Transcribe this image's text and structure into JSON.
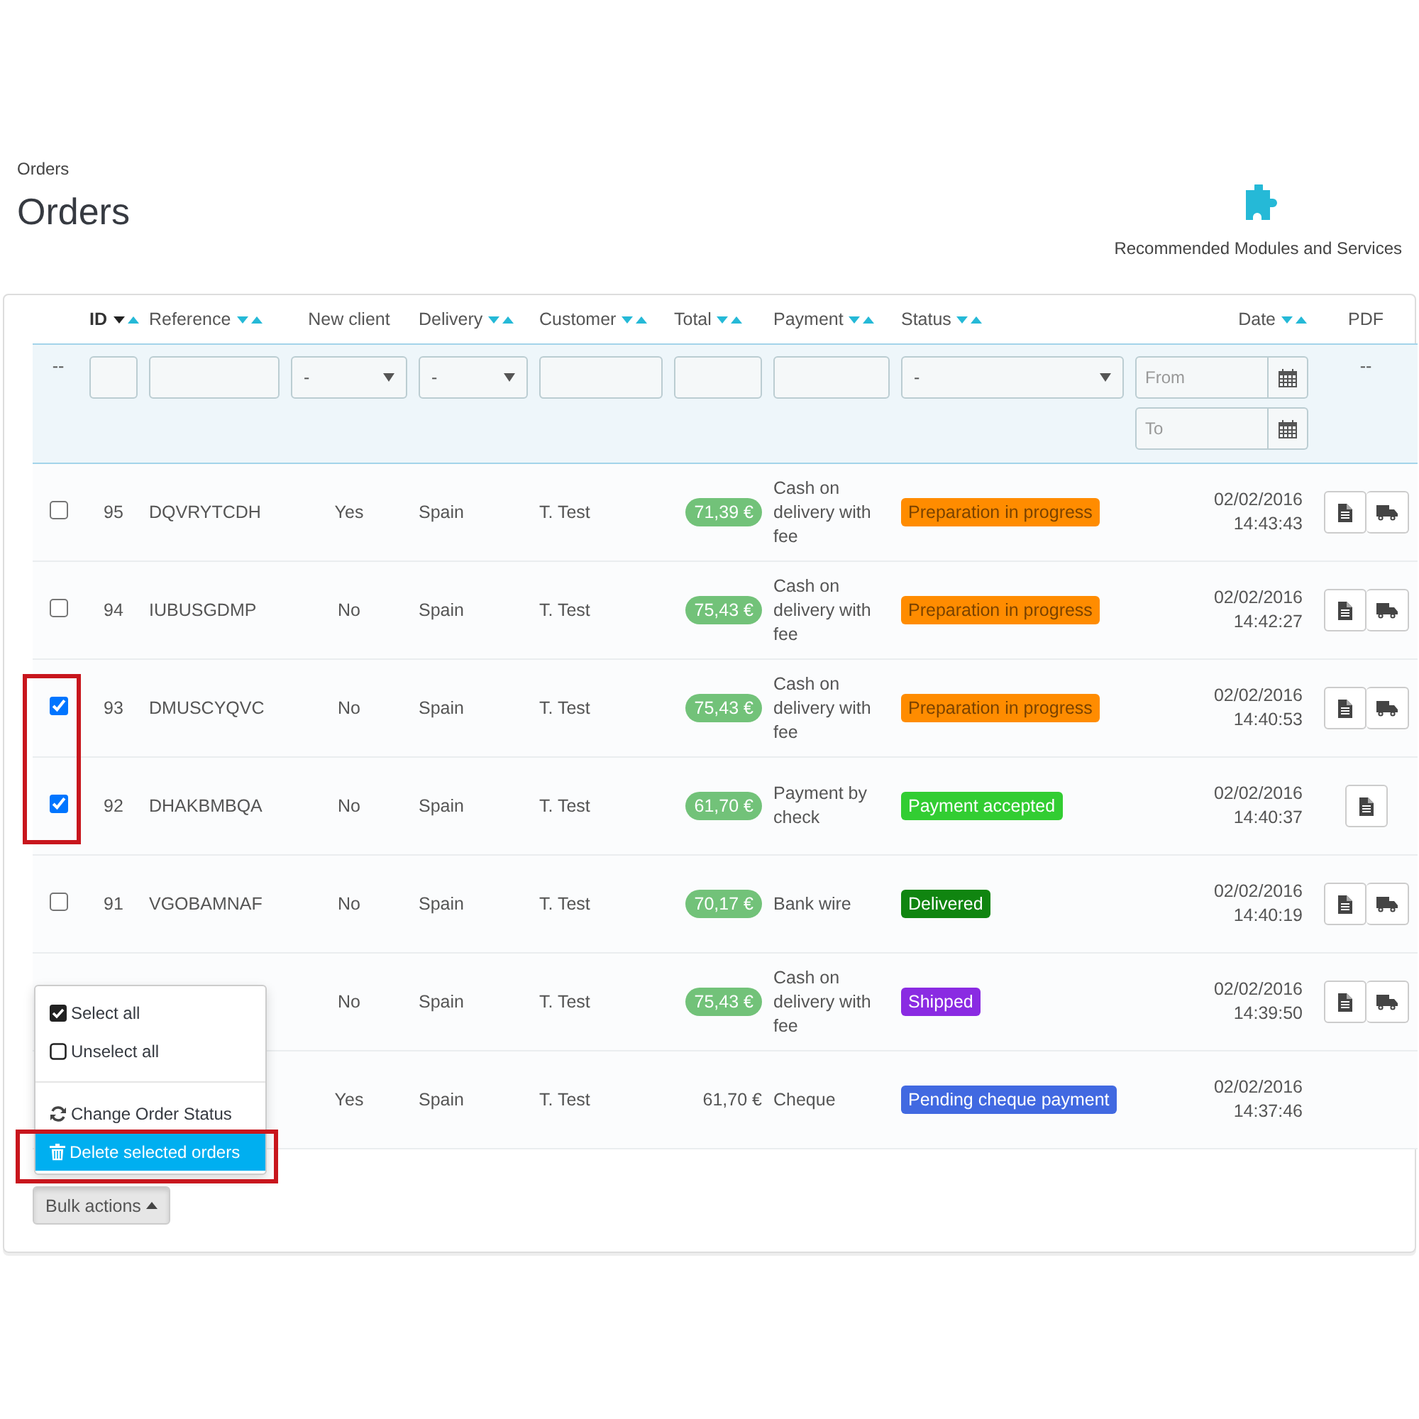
{
  "breadcrumb": "Orders",
  "title": "Orders",
  "toolbar_link": {
    "label": "Recommended Modules and Services"
  },
  "columns": [
    {
      "filter": {
        "kind": "dash",
        "text": "--"
      }
    },
    {
      "label": "ID",
      "kind": "sortable",
      "sorted": true,
      "filter": {
        "kind": "text"
      }
    },
    {
      "label": "Reference",
      "kind": "sortable",
      "sorted": false,
      "filter": {
        "kind": "text"
      }
    },
    {
      "label": "New client",
      "kind": "plain",
      "filter": {
        "kind": "select",
        "value": "-"
      }
    },
    {
      "label": "Delivery",
      "kind": "sortable",
      "sorted": false,
      "filter": {
        "kind": "select",
        "value": "-"
      }
    },
    {
      "label": "Customer",
      "kind": "sortable",
      "sorted": false,
      "filter": {
        "kind": "text"
      }
    },
    {
      "label": "Total",
      "kind": "sortable",
      "sorted": false,
      "filter": {
        "kind": "text"
      }
    },
    {
      "label": "Payment",
      "kind": "sortable",
      "sorted": false,
      "filter": {
        "kind": "text"
      }
    },
    {
      "label": "Status",
      "kind": "sortable",
      "sorted": false,
      "filter": {
        "kind": "select",
        "value": "-"
      }
    },
    {
      "label": "Date",
      "kind": "sortable",
      "sorted": false,
      "filter": {
        "kind": "date_range",
        "from_placeholder": "From",
        "to_placeholder": "To"
      }
    },
    {
      "label": "PDF",
      "kind": "plain",
      "filter": {
        "kind": "dash",
        "text": "--"
      }
    }
  ],
  "rows": [
    {
      "checkbox": {
        "checked": false,
        "highlighted": false
      },
      "id": "95",
      "reference": "DQVRYTCDH",
      "new_client": "Yes",
      "delivery": "Spain",
      "customer": "T. Test",
      "total": "71,39 €",
      "total_badge": true,
      "payment": "Cash on delivery with fee",
      "status": {
        "label": "Preparation in progress",
        "color": "#ff8c00",
        "dark_text": true
      },
      "date": "02/02/2016",
      "time": "14:43:43",
      "invoice": true,
      "delivery_slip": true
    },
    {
      "checkbox": {
        "checked": false,
        "highlighted": false
      },
      "id": "94",
      "reference": "IUBUSGDMP",
      "new_client": "No",
      "delivery": "Spain",
      "customer": "T. Test",
      "total": "75,43 €",
      "total_badge": true,
      "payment": "Cash on delivery with fee",
      "status": {
        "label": "Preparation in progress",
        "color": "#ff8c00",
        "dark_text": true
      },
      "date": "02/02/2016",
      "time": "14:42:27",
      "invoice": true,
      "delivery_slip": true
    },
    {
      "checkbox": {
        "checked": true,
        "highlighted": true
      },
      "id": "93",
      "reference": "DMUSCYQVC",
      "new_client": "No",
      "delivery": "Spain",
      "customer": "T. Test",
      "total": "75,43 €",
      "total_badge": true,
      "payment": "Cash on delivery with fee",
      "status": {
        "label": "Preparation in progress",
        "color": "#ff8c00",
        "dark_text": true
      },
      "date": "02/02/2016",
      "time": "14:40:53",
      "invoice": true,
      "delivery_slip": true
    },
    {
      "checkbox": {
        "checked": true,
        "highlighted": true
      },
      "id": "92",
      "reference": "DHAKBMBQA",
      "new_client": "No",
      "delivery": "Spain",
      "customer": "T. Test",
      "total": "61,70 €",
      "total_badge": true,
      "payment": "Payment by check",
      "status": {
        "label": "Payment accepted",
        "color": "#32cd32",
        "dark_text": false
      },
      "date": "02/02/2016",
      "time": "14:40:37",
      "invoice": true,
      "delivery_slip": false
    },
    {
      "checkbox": {
        "checked": false,
        "highlighted": false
      },
      "id": "91",
      "reference": "VGOBAMNAF",
      "new_client": "No",
      "delivery": "Spain",
      "customer": "T. Test",
      "total": "70,17 €",
      "total_badge": true,
      "payment": "Bank wire",
      "status": {
        "label": "Delivered",
        "color": "#108510",
        "dark_text": false
      },
      "date": "02/02/2016",
      "time": "14:40:19",
      "invoice": true,
      "delivery_slip": true
    },
    {
      "new_client": "No",
      "delivery": "Spain",
      "customer": "T. Test",
      "total": "75,43 €",
      "total_badge": true,
      "payment": "Cash on delivery with fee",
      "status": {
        "label": "Shipped",
        "color": "#8a2be2",
        "dark_text": false
      },
      "date": "02/02/2016",
      "time": "14:39:50",
      "invoice": true,
      "delivery_slip": true
    },
    {
      "new_client": "Yes",
      "delivery": "Spain",
      "customer": "T. Test",
      "total": "61,70 €",
      "total_badge": false,
      "payment": "Cheque",
      "status": {
        "label": "Pending cheque payment",
        "color": "#4169e1",
        "dark_text": false
      },
      "date": "02/02/2016",
      "time": "14:37:46",
      "invoice": false,
      "delivery_slip": false
    }
  ],
  "bulk_actions": {
    "label": "Bulk actions",
    "expanded": true,
    "menu_groups": [
      [
        {
          "label": "Select all",
          "selected": false,
          "highlighted": false
        },
        {
          "label": "Unselect all",
          "selected": false,
          "highlighted": false
        }
      ],
      [
        {
          "label": "Change Order Status",
          "selected": false,
          "highlighted": false
        },
        {
          "label": "Delete selected orders",
          "selected": true,
          "highlighted": true
        }
      ]
    ]
  }
}
